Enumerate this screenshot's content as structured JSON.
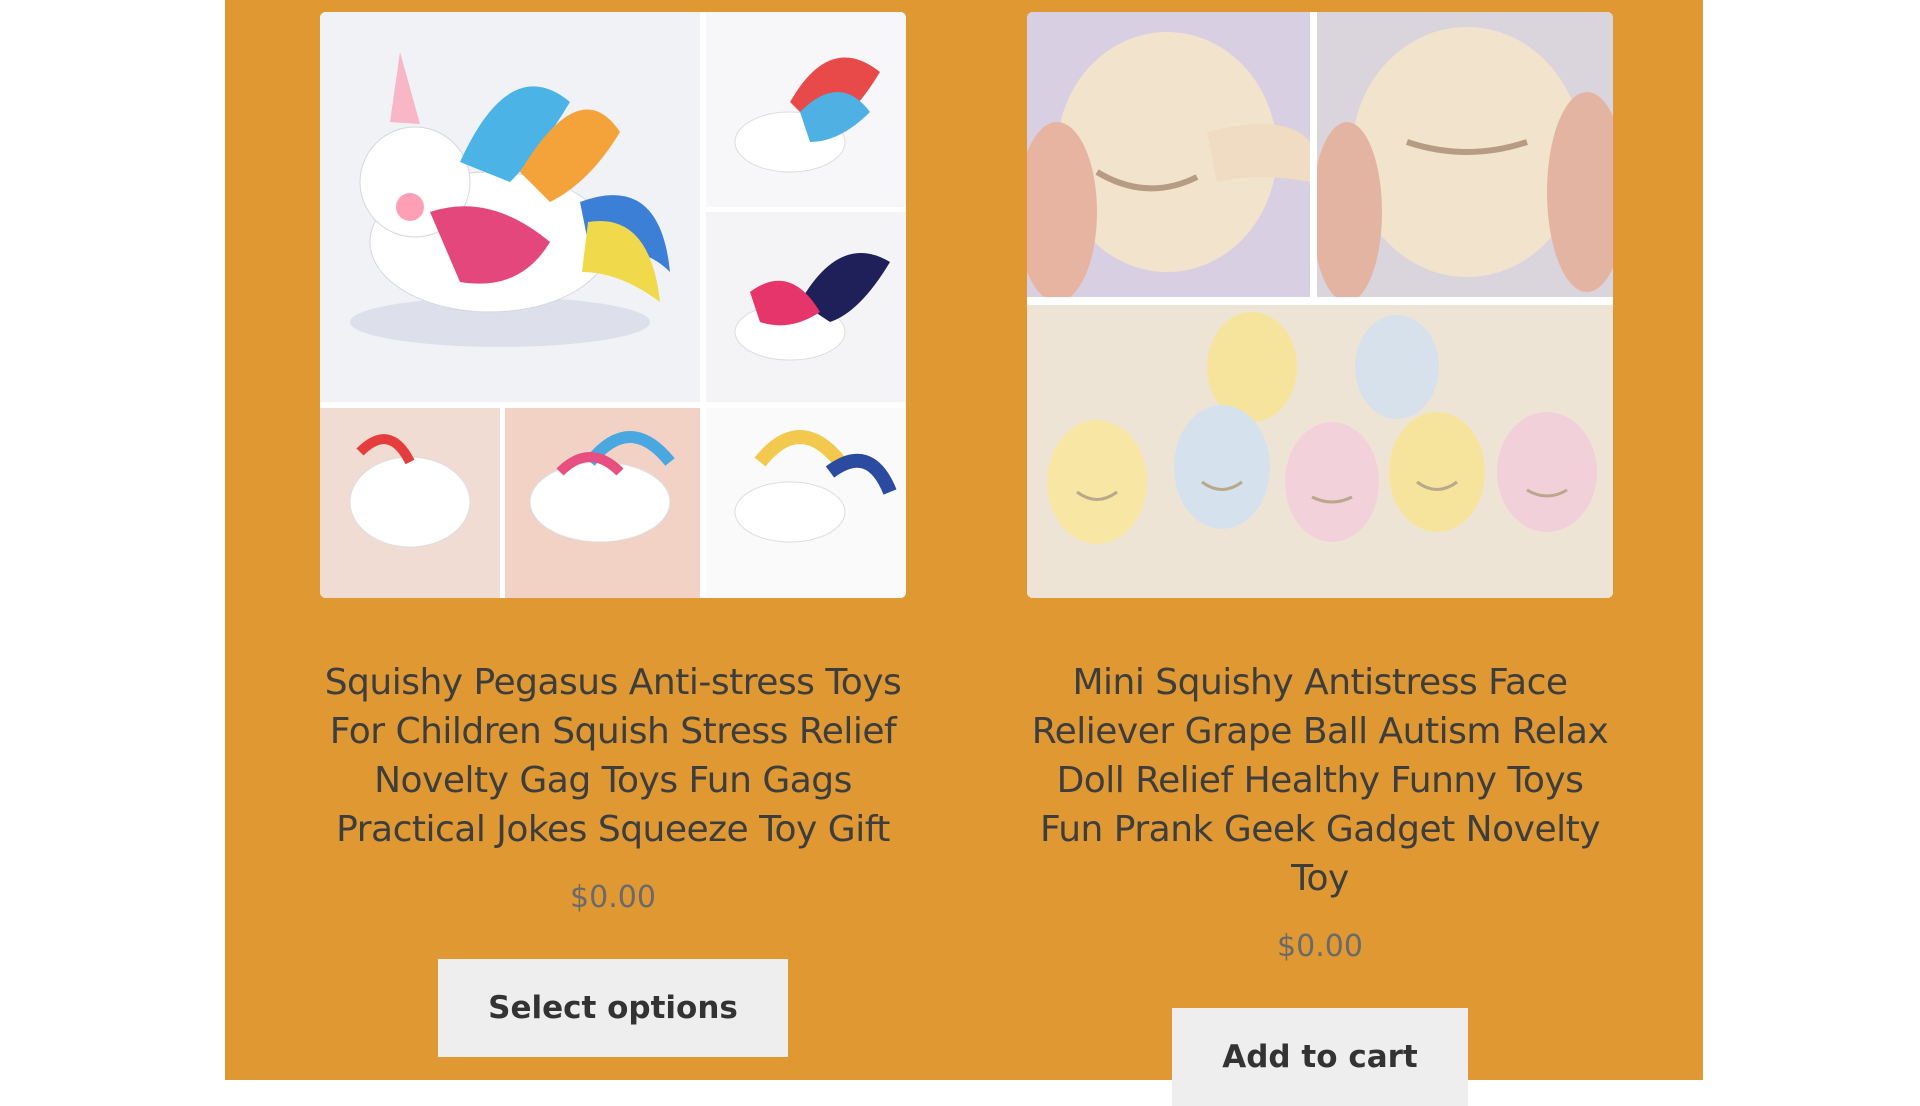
{
  "products": [
    {
      "title": "Squishy Pegasus Anti-stress Toys For Children Squish Stress Relief Novelty Gag Toys Fun Gags Practical Jokes Squeeze Toy Gift",
      "price": "$0.00",
      "button_label": "Select options",
      "image_icon": "unicorn-toy-image"
    },
    {
      "title": "Mini Squishy Antistress Face Reliever Grape Ball Autism Relax Doll Relief Healthy Funny Toys Fun Prank Geek Gadget Novelty Toy",
      "price": "$0.00",
      "button_label": "Add to cart",
      "image_icon": "squishy-face-image"
    }
  ],
  "colors": {
    "panel_background": "#df9832",
    "button_background": "#eeeeee",
    "title_text": "#3d3d3d",
    "price_text": "#6a6a6a"
  }
}
